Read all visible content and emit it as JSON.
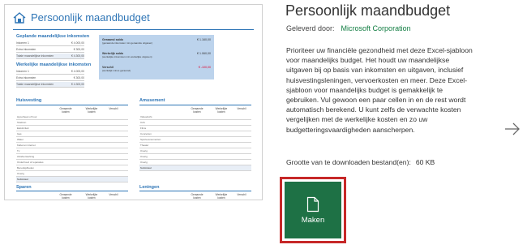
{
  "template_preview": {
    "title": "Persoonlijk maandbudget",
    "sections": {
      "planned_income": "Geplande maandelijkse inkomsten",
      "actual_income": "Werkelijke maandelijkse inkomsten",
      "housing": "Huisvesting",
      "entertainment": "Amusement",
      "savings": "Sparen",
      "loans": "Leningen"
    },
    "income_rows_planned": [
      {
        "label": "Inkomen 1",
        "value": "€ 4.000,00"
      },
      {
        "label": "Extra inkomsten",
        "value": "€ 300,00"
      },
      {
        "label": "Totale maandelijkse inkomsten",
        "value": "€ 4.300,00"
      }
    ],
    "income_rows_actual": [
      {
        "label": "Inkomen 1",
        "value": "€ 4.000,00"
      },
      {
        "label": "Extra inkomsten",
        "value": "€ 300,00"
      },
      {
        "label": "Totale maandelijkse inkomsten",
        "value": "€ 4.300,00"
      }
    ],
    "summary": [
      {
        "label": "Geraamd saldo",
        "sub": "(geraamde inkomsten min geraamde uitgaven)",
        "value": "€ 1.160,00"
      },
      {
        "label": "Werkelijk saldo",
        "sub": "(werkelijke inkomsten min werkelijke uitgaven)",
        "value": "€ 1.060,00"
      },
      {
        "label": "Verschil",
        "sub": "(werkelijk minus geraamd)",
        "value": "€ -100,00",
        "negative": true
      }
    ],
    "col_headers": [
      "Geraamde kosten",
      "Werkelijke kosten",
      "Verschil"
    ],
    "housing_rows": [
      "Hypotheek of huur",
      "Telefoon",
      "Elektriciteit",
      "Gas",
      "Water",
      "Kabel en internet",
      "Tv",
      "Afvalverwerking",
      "Onderhoud of reparaties",
      "Benodigdheden",
      "Overig"
    ],
    "housing_subtotal": "Subtotaal",
    "entertainment_rows": [
      "Videodvd's",
      "Cd's",
      "Films",
      "Concerten",
      "Sportevenementen",
      "Theater",
      "Overig",
      "Overig",
      "Overig"
    ],
    "entertainment_subtotal": "Subtotaal"
  },
  "details": {
    "title": "Persoonlijk maandbudget",
    "provided_by_label": "Geleverd door:",
    "publisher": "Microsoft Corporation",
    "description": "Prioriteer uw financiële gezondheid met deze Excel-sjabloon voor maandelijks budget. Het houdt uw maandelijkse uitgaven bij op basis van inkomsten en uitgaven, inclusief huisvestingsleningen, vervoerkosten en meer. Deze Excel-sjabloon voor maandelijks budget is gemakkelijk te gebruiken. Vul gewoon een paar cellen in en de rest wordt automatisch berekend. U kunt zelfs de verwachte kosten vergelijken met de werkelijke kosten en zo uw budgetteringsvaardigheden aanscherpen.",
    "download_size_label": "Grootte van te downloaden bestand(en):",
    "download_size_value": "60 KB",
    "create_label": "Maken"
  },
  "colors": {
    "accent_green": "#1e7145",
    "publisher_green": "#107c41",
    "highlight_red": "#c62828",
    "template_blue": "#2e75b6"
  },
  "icons": {
    "create": "new-document-icon",
    "next": "arrow-right-icon",
    "template_logo": "house-icon"
  }
}
